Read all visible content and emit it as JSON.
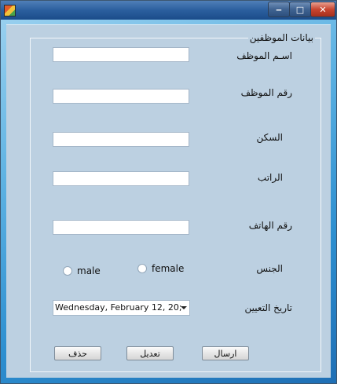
{
  "window": {
    "controls": {
      "minimize": "‒",
      "maximize": "□",
      "close": "✕"
    }
  },
  "group": {
    "title": "بيانات الموظفين"
  },
  "fields": {
    "employee_name": {
      "label": "اسـم الموظف",
      "value": ""
    },
    "employee_number": {
      "label": "رقم الموظف",
      "value": ""
    },
    "residence": {
      "label": "السكن",
      "value": ""
    },
    "salary": {
      "label": "الراتب",
      "value": ""
    },
    "phone": {
      "label": "رقم الهاتف",
      "value": ""
    },
    "gender": {
      "label": "الجنس",
      "options": [
        "male",
        "female"
      ],
      "selected": null
    },
    "hire_date": {
      "label": "تاريخ التعيين",
      "value": "Wednesday,   February  12, 20;"
    }
  },
  "buttons": {
    "send": "ارسال",
    "edit": "تعديل",
    "delete": "حذف"
  }
}
